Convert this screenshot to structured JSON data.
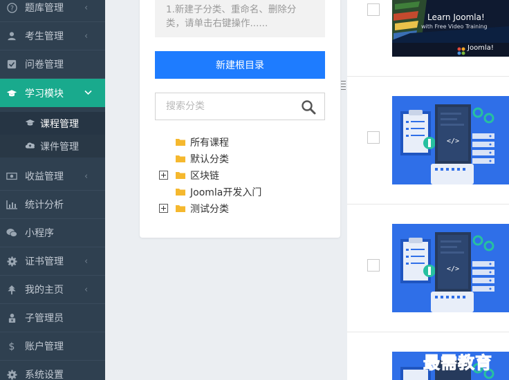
{
  "sidebar": {
    "items": [
      {
        "label": "题库管理",
        "icon": "question-circle-icon",
        "has_chevron": true
      },
      {
        "label": "考生管理",
        "icon": "user-icon",
        "has_chevron": true
      },
      {
        "label": "问卷管理",
        "icon": "check-square-icon",
        "has_chevron": false
      },
      {
        "label": "学习模块",
        "icon": "graduation-cap-icon",
        "has_chevron": true,
        "active": true
      },
      {
        "label": "收益管理",
        "icon": "money-icon",
        "has_chevron": true
      },
      {
        "label": "统计分析",
        "icon": "bar-chart-icon",
        "has_chevron": false
      },
      {
        "label": "小程序",
        "icon": "wechat-icon",
        "has_chevron": false
      },
      {
        "label": "证书管理",
        "icon": "gear-icon",
        "has_chevron": true
      },
      {
        "label": "我的主页",
        "icon": "tree-icon",
        "has_chevron": true
      },
      {
        "label": "子管理员",
        "icon": "user-lock-icon",
        "has_chevron": false
      },
      {
        "label": "账户管理",
        "icon": "dollar-icon",
        "has_chevron": false
      },
      {
        "label": "系统设置",
        "icon": "cog-icon",
        "has_chevron": false
      }
    ],
    "subitems": [
      {
        "label": "课程管理",
        "icon": "graduation-cap-icon",
        "current": true
      },
      {
        "label": "课件管理",
        "icon": "cloud-upload-icon",
        "current": false
      }
    ],
    "chevron_collapsed": "‹",
    "chevron_expanded": "⌄"
  },
  "category_panel": {
    "tip_line1": "1.新建子分类、重命名、删除分",
    "tip_line2": "类，请单击右键操作......",
    "new_root_button": "新建根目录",
    "search_placeholder": "搜索分类",
    "tree": [
      {
        "label": "所有课程",
        "expandable": false
      },
      {
        "label": "默认分类",
        "expandable": false
      },
      {
        "label": "区块链",
        "expandable": true
      },
      {
        "label": "Joomla开发入门",
        "expandable": false
      },
      {
        "label": "测试分类",
        "expandable": true
      }
    ]
  },
  "course_list": {
    "rows": [
      {
        "thumbnail": "joomla-course-banner",
        "banner_line1": "Learn Joomla!",
        "banner_line2": "with Free Video Training",
        "banner_brand": "Joomla!"
      },
      {
        "thumbnail": "developer-illustration"
      },
      {
        "thumbnail": "developer-illustration"
      },
      {
        "thumbnail": "developer-illustration"
      }
    ]
  },
  "watermark": "最需教育",
  "colors": {
    "sidebar_bg": "#2f4050",
    "active": "#19aa8d",
    "primary_button": "#1e7cff",
    "folder": "#f5b82e",
    "thumb_blue": "#2f6fe8"
  }
}
